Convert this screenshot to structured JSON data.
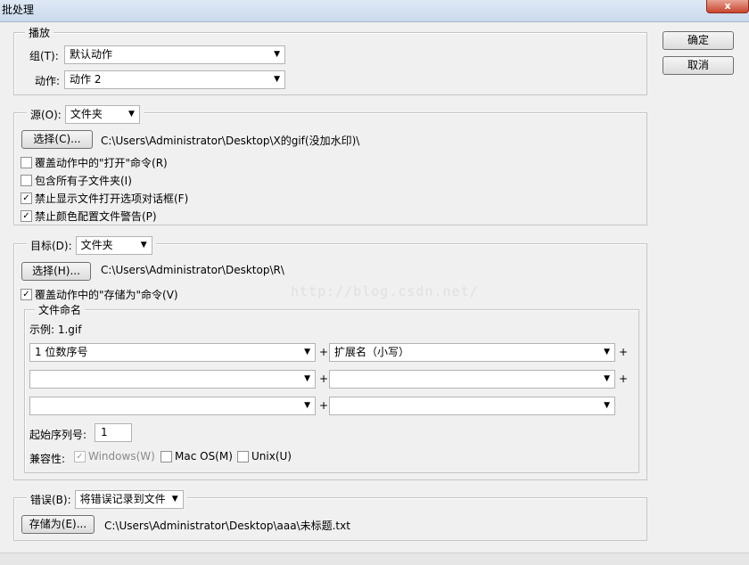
{
  "window": {
    "title": "批处理",
    "close_label": "x"
  },
  "buttons": {
    "ok": "确定",
    "cancel": "取消"
  },
  "play": {
    "legend": "播放",
    "set_label": "组(T):",
    "set_value": "默认动作",
    "action_label": "动作:",
    "action_value": "动作 2"
  },
  "source": {
    "legend_label": "源(O):",
    "type_value": "文件夹",
    "choose_button": "选择(C)...",
    "path": "C:\\Users\\Administrator\\Desktop\\X的gif(没加水印)\\",
    "options": [
      {
        "label": "覆盖动作中的\"打开\"命令(R)",
        "checked": false
      },
      {
        "label": "包含所有子文件夹(I)",
        "checked": false
      },
      {
        "label": "禁止显示文件打开选项对话框(F)",
        "checked": true
      },
      {
        "label": "禁止颜色配置文件警告(P)",
        "checked": true
      }
    ]
  },
  "destination": {
    "legend_label": "目标(D):",
    "type_value": "文件夹",
    "choose_button": "选择(H)...",
    "path": "C:\\Users\\Administrator\\Desktop\\R\\",
    "override_save": {
      "label": "覆盖动作中的\"存储为\"命令(V)",
      "checked": true
    },
    "watermark": "http://blog.csdn.net/"
  },
  "naming": {
    "legend": "文件命名",
    "example": "示例: 1.gif",
    "fields": [
      {
        "left": "1 位数序号",
        "right": "扩展名（小写）"
      },
      {
        "left": "",
        "right": ""
      },
      {
        "left": "",
        "right": ""
      }
    ],
    "plus": "+",
    "start_serial_label": "起始序列号:",
    "start_serial_value": "1",
    "compat_label": "兼容性:",
    "compat": [
      {
        "label": "Windows(W)",
        "checked": true,
        "disabled": true
      },
      {
        "label": "Mac OS(M)",
        "checked": false,
        "disabled": false
      },
      {
        "label": "Unix(U)",
        "checked": false,
        "disabled": false
      }
    ]
  },
  "errors": {
    "legend_label": "错误(B):",
    "value": "将错误记录到文件",
    "save_button": "存储为(E)...",
    "path": "C:\\Users\\Administrator\\Desktop\\aaa\\未标题.txt"
  }
}
